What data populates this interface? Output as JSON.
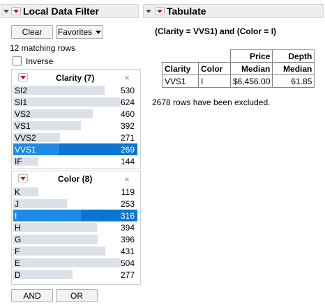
{
  "local_data_filter": {
    "title": "Local Data Filter",
    "clear_label": "Clear",
    "favorites_label": "Favorites",
    "matching_rows": "12 matching rows",
    "inverse_label": "Inverse",
    "inverse_checked": false,
    "clarity_filter": {
      "title": "Clarity (7)",
      "close_icon": "×",
      "items": [
        {
          "label": "SI2",
          "count": "530",
          "selected": false
        },
        {
          "label": "SI1",
          "count": "624",
          "selected": false
        },
        {
          "label": "VS2",
          "count": "460",
          "selected": false
        },
        {
          "label": "VS1",
          "count": "392",
          "selected": false
        },
        {
          "label": "VVS2",
          "count": "271",
          "selected": false
        },
        {
          "label": "VVS1",
          "count": "269",
          "selected": true
        },
        {
          "label": "IF",
          "count": "144",
          "selected": false
        }
      ]
    },
    "color_filter": {
      "title": "Color (8)",
      "close_icon": "×",
      "items": [
        {
          "label": "K",
          "count": "119",
          "selected": false
        },
        {
          "label": "J",
          "count": "253",
          "selected": false
        },
        {
          "label": "I",
          "count": "316",
          "selected": true
        },
        {
          "label": "H",
          "count": "394",
          "selected": false
        },
        {
          "label": "G",
          "count": "396",
          "selected": false
        },
        {
          "label": "F",
          "count": "431",
          "selected": false
        },
        {
          "label": "E",
          "count": "504",
          "selected": false
        },
        {
          "label": "D",
          "count": "277",
          "selected": false
        }
      ]
    },
    "and_label": "AND",
    "or_label": "OR"
  },
  "tabulate": {
    "title": "Tabulate",
    "where_clause": "(Clarity = VVS1) and (Color = I)",
    "table": {
      "group_headers": [
        "Price",
        "Depth"
      ],
      "columns": [
        "Clarity",
        "Color",
        "Median",
        "Median"
      ],
      "row": [
        "VVS1",
        "I",
        "$6,456.00",
        "61.85"
      ]
    },
    "excluded_note": "2678 rows have been excluded."
  },
  "colors": {
    "selection": "#0a76d2",
    "bar": "#dce1e7",
    "menu_triangle": "#c8102e"
  },
  "icons": {
    "outline_toggle": "disclosure-triangle-icon",
    "menu": "red-triangle-menu-icon",
    "close": "close-icon",
    "dropdown": "chevron-down-icon"
  }
}
